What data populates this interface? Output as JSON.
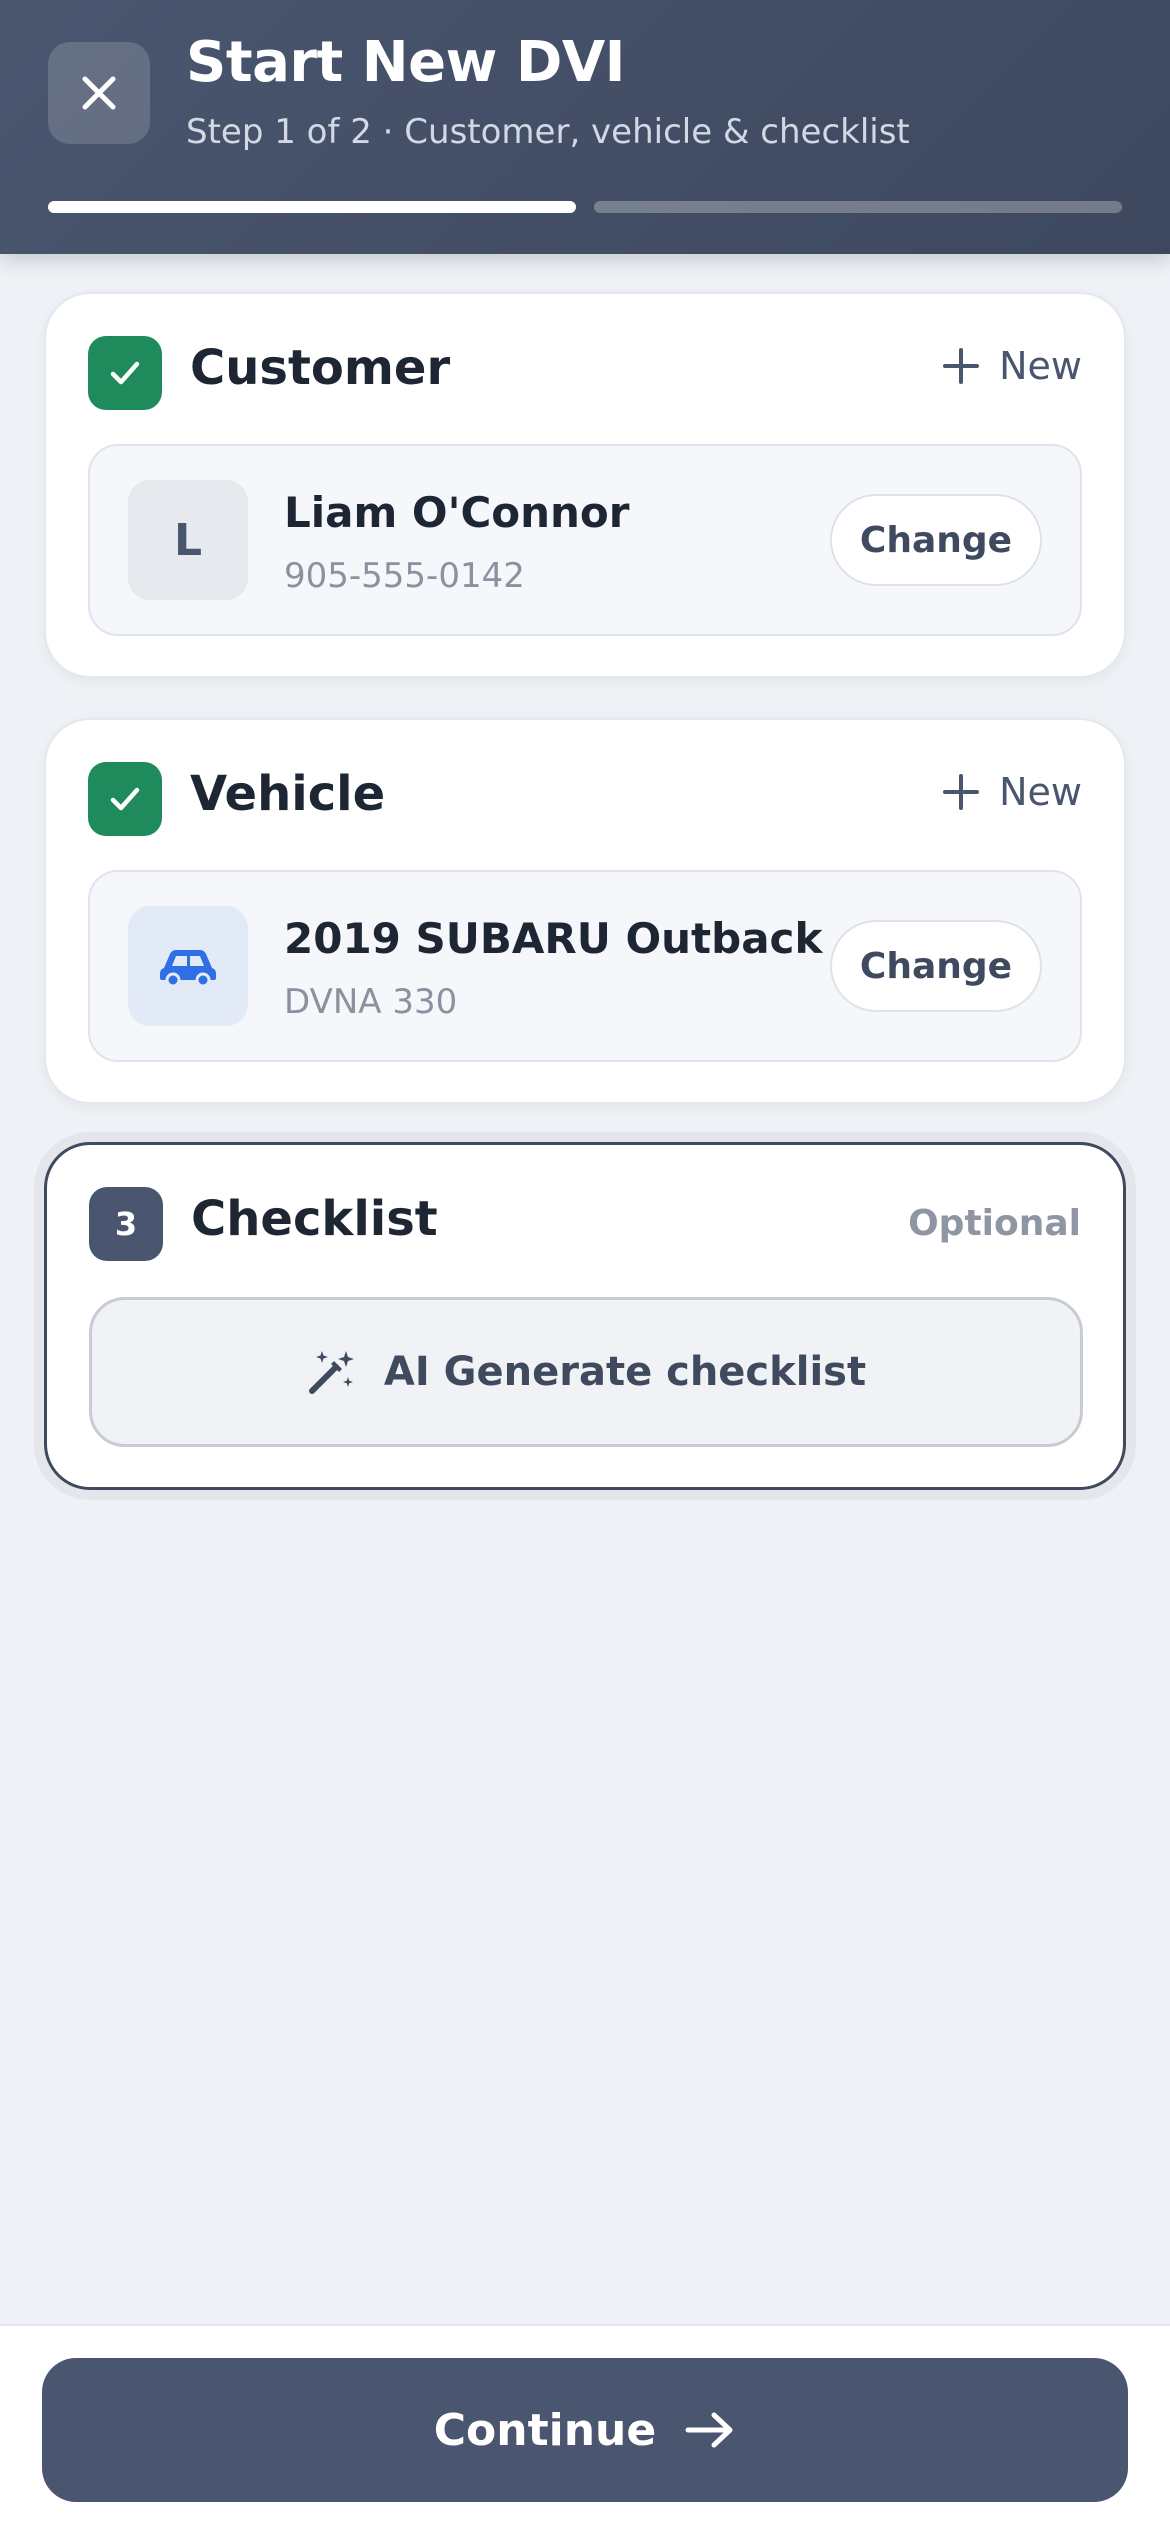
{
  "header": {
    "title": "Start New DVI",
    "subtitle": "Step 1 of 2 · Customer, vehicle & checklist",
    "close_icon": "close-icon",
    "step_current": 1,
    "step_total": 2
  },
  "customer": {
    "title": "Customer",
    "new_label": "New",
    "selected": {
      "initial": "L",
      "name": "Liam O'Connor",
      "phone": "905-555-0142"
    },
    "change_label": "Change"
  },
  "vehicle": {
    "title": "Vehicle",
    "new_label": "New",
    "selected": {
      "name": "2019 SUBARU Outback",
      "plate": "DVNA 330"
    },
    "change_label": "Change"
  },
  "checklist": {
    "step_number": "3",
    "title": "Checklist",
    "optional_label": "Optional",
    "ai_button_label": "AI Generate checklist"
  },
  "footer": {
    "continue_label": "Continue"
  },
  "colors": {
    "header_bg": "#4a566f",
    "done_green": "#1f8a5b",
    "accent_dark": "#3f4a5f",
    "car_icon_blue": "#2f6fe4",
    "page_bg": "#eef1f5"
  }
}
